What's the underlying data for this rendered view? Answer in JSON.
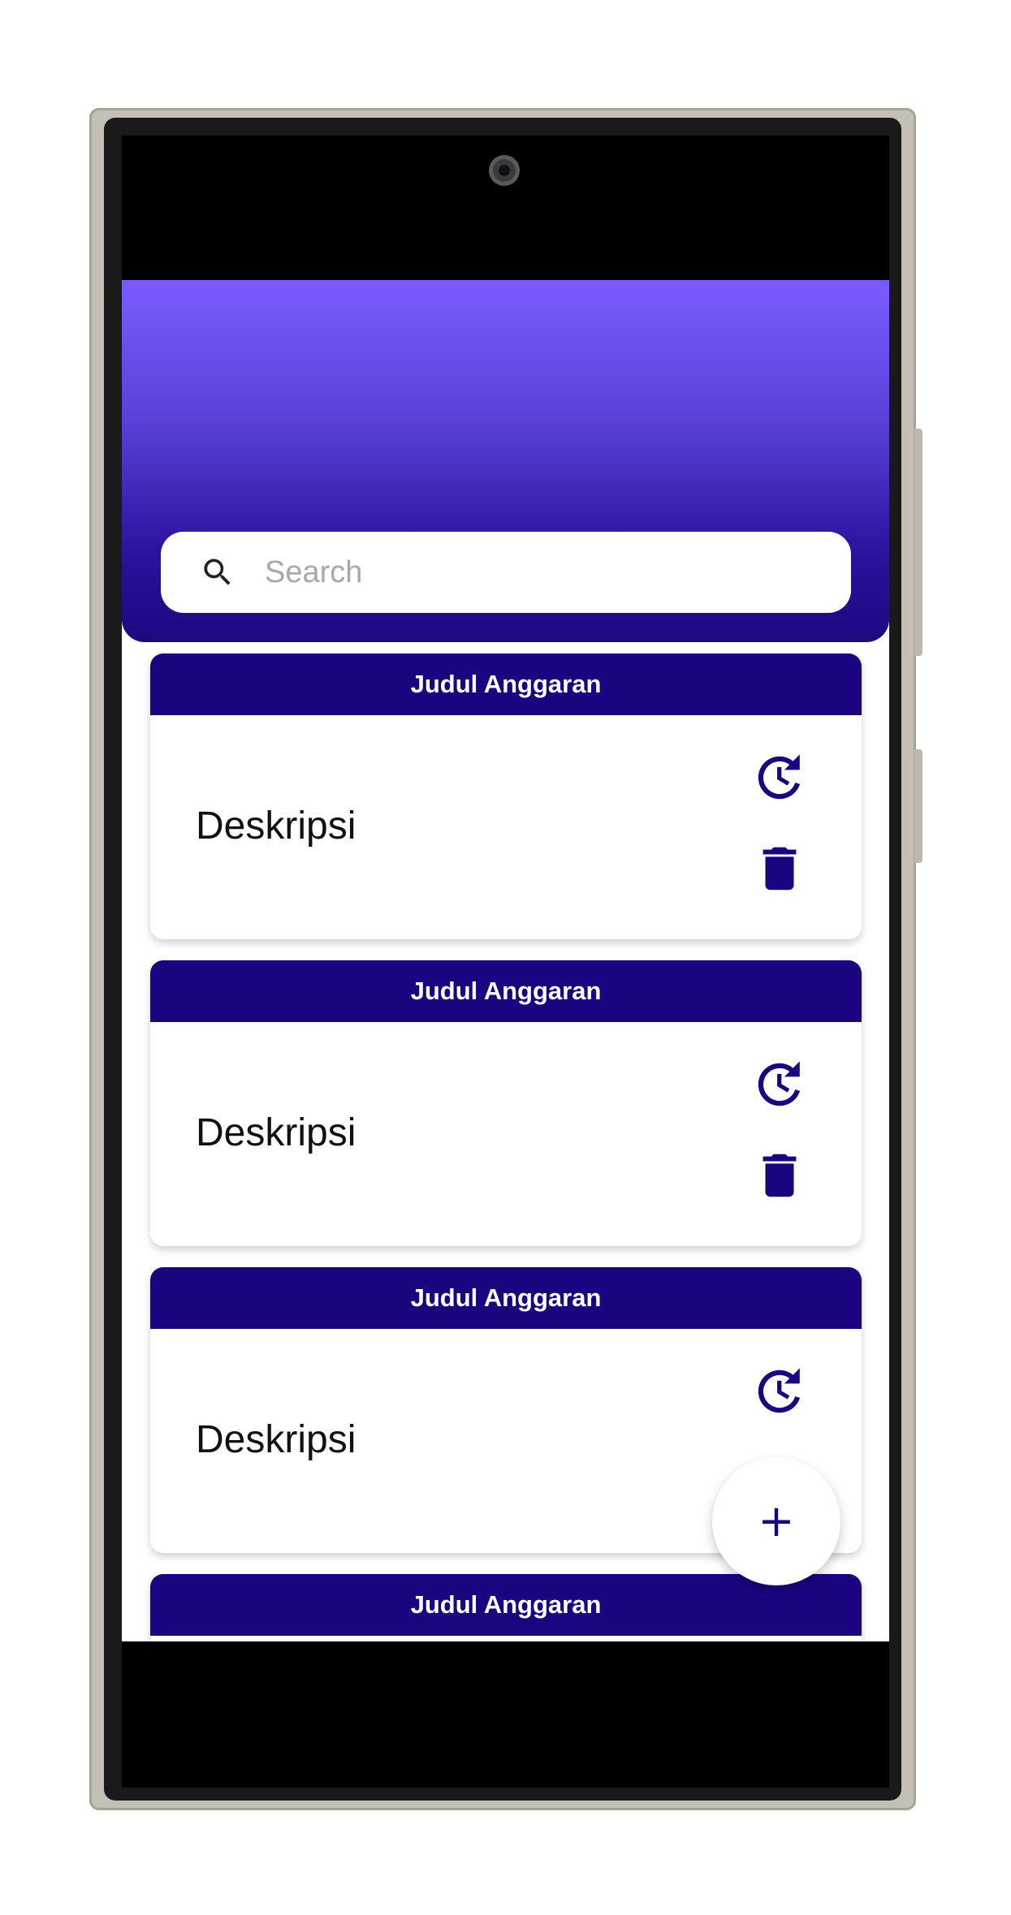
{
  "search": {
    "placeholder": "Search",
    "value": ""
  },
  "cards": [
    {
      "title": "Judul Anggaran",
      "description": "Deskripsi"
    },
    {
      "title": "Judul Anggaran",
      "description": "Deskripsi"
    },
    {
      "title": "Judul Anggaran",
      "description": "Deskripsi"
    },
    {
      "title": "Judul Anggaran",
      "description": ""
    }
  ],
  "fab": {
    "label": "+"
  },
  "icons": {
    "search": "search-icon",
    "history": "history-icon",
    "delete": "trash-icon",
    "add": "plus-icon"
  },
  "colors": {
    "primary": "#1b0480",
    "header_top": "#7b5cff",
    "header_bottom": "#1e0880",
    "surface": "#ffffff"
  }
}
